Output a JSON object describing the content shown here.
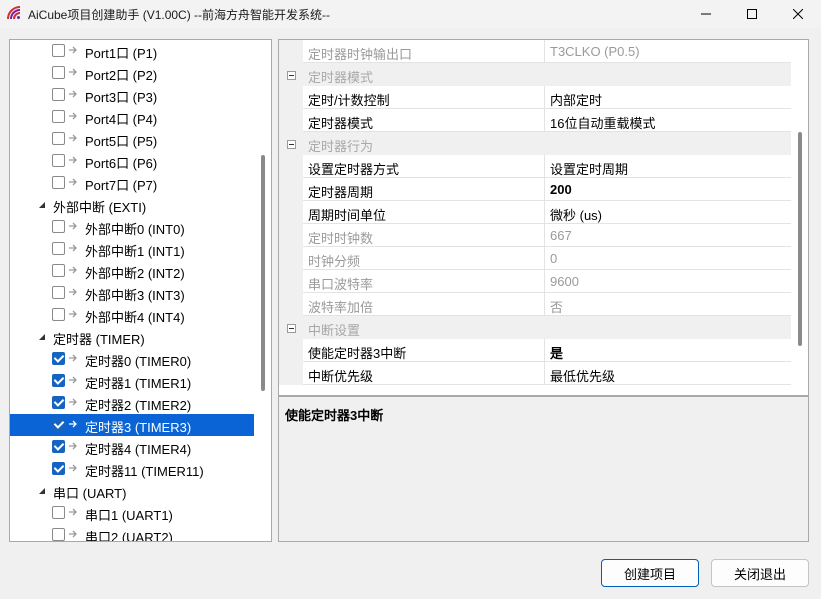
{
  "window": {
    "title": "AiCube项目创建助手 (V1.00C) --前海方舟智能开发系统--"
  },
  "tree": [
    {
      "label": "Port1口 (P1)",
      "level": 1,
      "checked": false
    },
    {
      "label": "Port2口 (P2)",
      "level": 1,
      "checked": false
    },
    {
      "label": "Port3口 (P3)",
      "level": 1,
      "checked": false
    },
    {
      "label": "Port4口 (P4)",
      "level": 1,
      "checked": false
    },
    {
      "label": "Port5口 (P5)",
      "level": 1,
      "checked": false
    },
    {
      "label": "Port6口 (P6)",
      "level": 1,
      "checked": false
    },
    {
      "label": "Port7口 (P7)",
      "level": 1,
      "checked": false
    },
    {
      "label": "外部中断 (EXTI)",
      "level": 0
    },
    {
      "label": "外部中断0 (INT0)",
      "level": 1,
      "checked": false
    },
    {
      "label": "外部中断1 (INT1)",
      "level": 1,
      "checked": false
    },
    {
      "label": "外部中断2 (INT2)",
      "level": 1,
      "checked": false
    },
    {
      "label": "外部中断3 (INT3)",
      "level": 1,
      "checked": false
    },
    {
      "label": "外部中断4 (INT4)",
      "level": 1,
      "checked": false
    },
    {
      "label": "定时器 (TIMER)",
      "level": 0
    },
    {
      "label": "定时器0 (TIMER0)",
      "level": 1,
      "checked": true
    },
    {
      "label": "定时器1 (TIMER1)",
      "level": 1,
      "checked": true
    },
    {
      "label": "定时器2 (TIMER2)",
      "level": 1,
      "checked": true
    },
    {
      "label": "定时器3 (TIMER3)",
      "level": 1,
      "checked": true,
      "selected": true
    },
    {
      "label": "定时器4 (TIMER4)",
      "level": 1,
      "checked": true
    },
    {
      "label": "定时器11 (TIMER11)",
      "level": 1,
      "checked": true
    },
    {
      "label": "串口 (UART)",
      "level": 0
    },
    {
      "label": "串口1 (UART1)",
      "level": 1,
      "checked": false
    },
    {
      "label": "串口2 (UART2)",
      "level": 1,
      "checked": false
    }
  ],
  "properties": [
    {
      "kind": "prop",
      "name": "定时器时钟输出口",
      "value": "T3CLKO (P0.5)",
      "readonly": true
    },
    {
      "kind": "category",
      "label": "定时器模式"
    },
    {
      "kind": "prop",
      "name": "定时/计数控制",
      "value": "内部定时"
    },
    {
      "kind": "prop",
      "name": "定时器模式",
      "value": "16位自动重载模式"
    },
    {
      "kind": "category",
      "label": "定时器行为"
    },
    {
      "kind": "prop",
      "name": "设置定时器方式",
      "value": "设置定时周期"
    },
    {
      "kind": "prop",
      "name": "定时器周期",
      "value": "200",
      "bold": true
    },
    {
      "kind": "prop",
      "name": "周期时间单位",
      "value": "微秒 (us)"
    },
    {
      "kind": "prop",
      "name": "定时时钟数",
      "value": "667",
      "readonly": true
    },
    {
      "kind": "prop",
      "name": "时钟分频",
      "value": "0",
      "readonly": true
    },
    {
      "kind": "prop",
      "name": "串口波特率",
      "value": "9600",
      "readonly": true
    },
    {
      "kind": "prop",
      "name": "波特率加倍",
      "value": "否",
      "readonly": true
    },
    {
      "kind": "category",
      "label": "中断设置"
    },
    {
      "kind": "prop",
      "name": "使能定时器3中断",
      "value": "是",
      "bold": true,
      "dropdown": true
    },
    {
      "kind": "prop",
      "name": "中断优先级",
      "value": "最低优先级"
    }
  ],
  "description": {
    "title": "使能定时器3中断"
  },
  "buttons": {
    "create": "创建项目",
    "exit": "关闭退出"
  }
}
